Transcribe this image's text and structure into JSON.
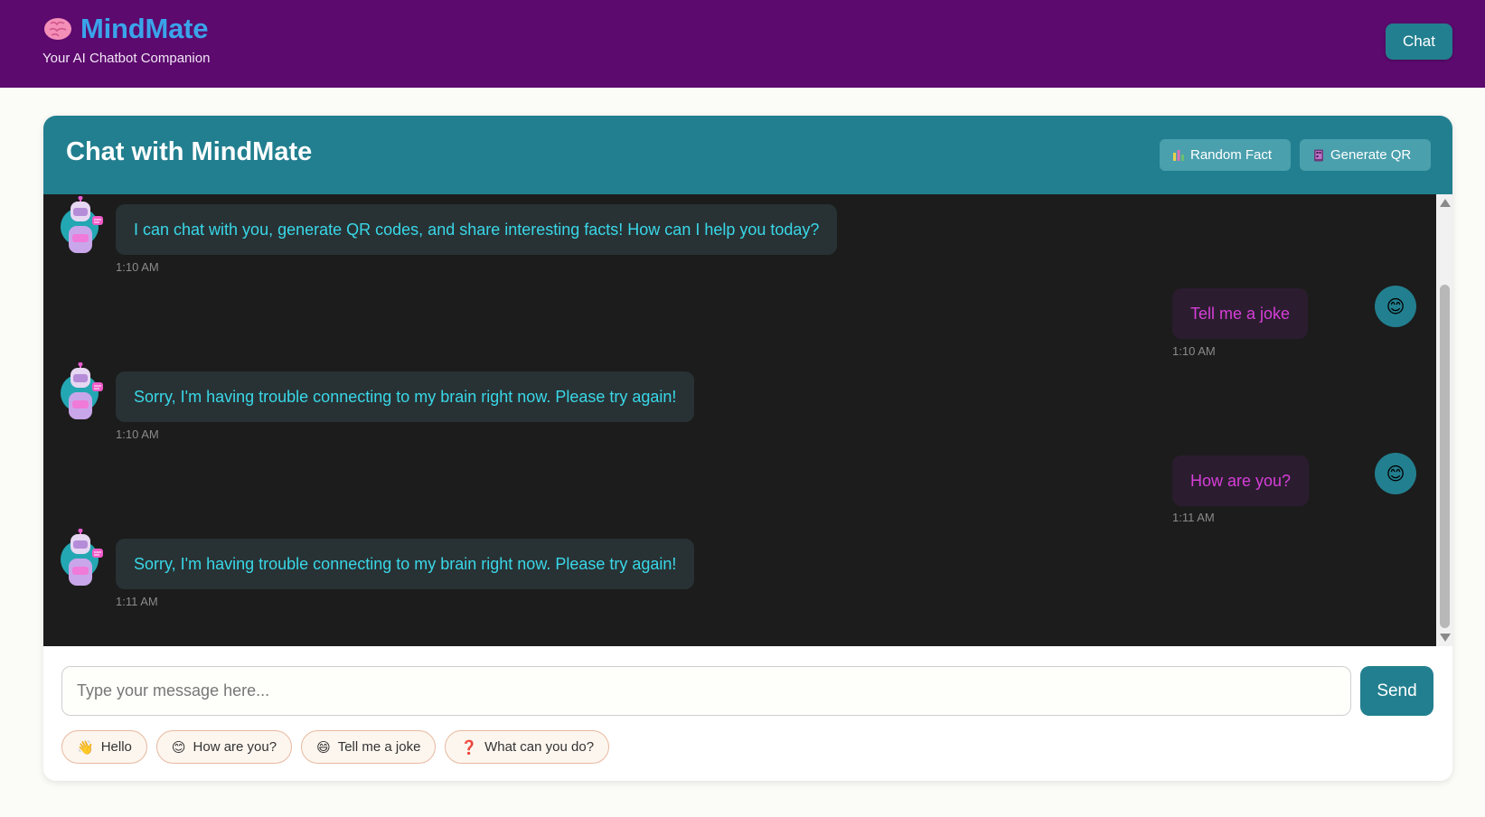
{
  "header": {
    "brand_icon": "brain-icon",
    "brand_title": "MindMate",
    "brand_subtitle": "Your AI Chatbot Companion",
    "nav_chat_label": "Chat"
  },
  "chat": {
    "title": "Chat with MindMate",
    "random_fact_label": "Random Fact",
    "random_fact_icon": "bar-chart-icon",
    "generate_qr_label": "Generate QR",
    "generate_qr_icon": "qr-phone-icon"
  },
  "messages": [
    {
      "sender": "bot",
      "text": "I can chat with you, generate QR codes, and share interesting facts! How can I help you today?",
      "time": "1:10 AM"
    },
    {
      "sender": "user",
      "text": "Tell me a joke",
      "time": "1:10 AM"
    },
    {
      "sender": "bot",
      "text": "Sorry, I'm having trouble connecting to my brain right now. Please try again!",
      "time": "1:10 AM"
    },
    {
      "sender": "user",
      "text": "How are you?",
      "time": "1:11 AM"
    },
    {
      "sender": "bot",
      "text": "Sorry, I'm having trouble connecting to my brain right now. Please try again!",
      "time": "1:11 AM"
    }
  ],
  "input": {
    "placeholder": "Type your message here...",
    "value": "",
    "send_label": "Send"
  },
  "quick_replies": [
    {
      "emoji": "👋",
      "label": "Hello"
    },
    {
      "emoji": "😊",
      "label": "How are you?"
    },
    {
      "emoji": "😄",
      "label": "Tell me a joke"
    },
    {
      "emoji": "❓",
      "label": "What can you do?"
    }
  ],
  "user_avatar_emoji": "😊",
  "colors": {
    "topbar": "#5c0a6e",
    "brand": "#3aa4ea",
    "teal": "#227f8f",
    "chat_bg": "#1c1c1c",
    "bot_text": "#39d7e8",
    "user_text": "#d63ed8"
  }
}
